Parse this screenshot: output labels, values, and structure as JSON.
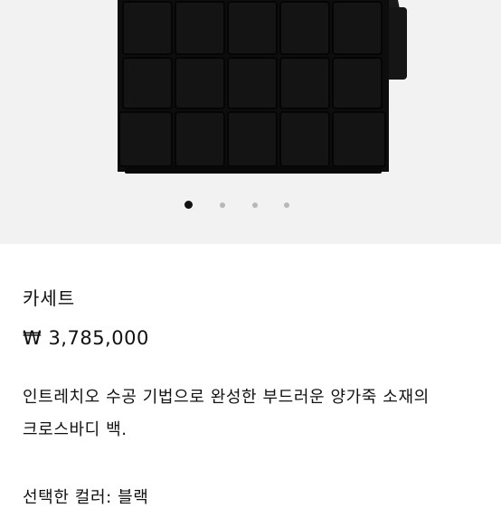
{
  "product": {
    "name": "카세트",
    "price": "₩ 3,785,000",
    "description_line1": "인트레치오 수공 기법으로 완성한 부드러운 양가죽 소재의",
    "description_line2": "크로스바디 백.",
    "selected_color": "선택한 컬러: 블랙"
  },
  "gallery": {
    "image_icon": "black-woven-leather-crossbody-bag",
    "dot_count": 4,
    "active_index": 0,
    "colors": {
      "background": "#f2f2f2",
      "active_dot": "#111111",
      "inactive_dot": "#b8b8b8"
    }
  }
}
